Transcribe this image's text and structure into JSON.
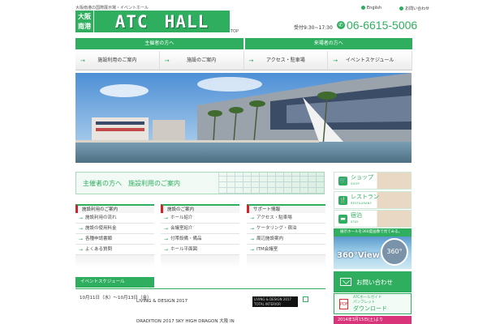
{
  "header": {
    "tagline": "大阪南港の国際展示場・イベントホール",
    "logo": {
      "city_line1": "大阪",
      "city_line2": "南港",
      "word1": "ATC",
      "word2": "HALL"
    },
    "top_label": "TOP",
    "lang": [
      {
        "label": "English"
      },
      {
        "label": "お問い合わせ"
      }
    ],
    "hours": "受付9:30~17:30",
    "phone": "06-6615-5006"
  },
  "nav": {
    "tabs": [
      "主催者の方へ",
      "来場者の方へ"
    ],
    "subnav": [
      "施設利用のご案内",
      "施設のご案内",
      "アクセス・駐車場",
      "イベントスケジュール"
    ]
  },
  "banner": {
    "prefix": "主催者の方へ",
    "text": "施設利用のご案内"
  },
  "columns": [
    {
      "title": "施設利用のご案内",
      "items": [
        "施設利用の流れ",
        "施設の使用料金",
        "各種申請書類",
        "よくある質問"
      ]
    },
    {
      "title": "施設のご案内",
      "items": [
        "ホール紹介",
        "会議室紹介",
        "付帯設備・備品",
        "ホール平面図"
      ]
    },
    {
      "title": "サポート情報",
      "items": [
        "アクセス・駐車場",
        "ケータリング・宿泊",
        "周辺施設案内",
        "ITM会議室"
      ]
    }
  ],
  "news": {
    "heading": "イベントスケジュール",
    "items": [
      {
        "date": "10月11日（水）～10月13日（金）",
        "title": "LIVING & DESIGN 2017",
        "thumb_title": "LIVING & DESIGN 2017",
        "thumb_sub": "TOTAL INTERIOR"
      },
      {
        "date": "",
        "title": "DRADITION 2017 SKY HIGH DRAGON 大阪 IN"
      }
    ]
  },
  "sidebar": {
    "services": [
      {
        "jp": "ショップ",
        "en": "SHOP",
        "icon": "cart-icon"
      },
      {
        "jp": "レストラン",
        "en": "RESTAURANT",
        "icon": "dining-icon"
      },
      {
        "jp": "宿泊",
        "en": "STAY",
        "icon": "bed-icon"
      }
    ],
    "view360": {
      "top": "展示ホールを360度画像で見てみる。",
      "label": "360°View",
      "badge": "360°"
    },
    "contact": "お問い合わせ",
    "guide": {
      "line1": "ATCホールガイド",
      "line2": "パンフレット",
      "download": "ダウンロード"
    },
    "date_strip": "2014年3月15日(土)より"
  },
  "colors": {
    "brand_green": "#2fae5f",
    "accent_red": "#d0232a",
    "pink": "#d9347a"
  }
}
